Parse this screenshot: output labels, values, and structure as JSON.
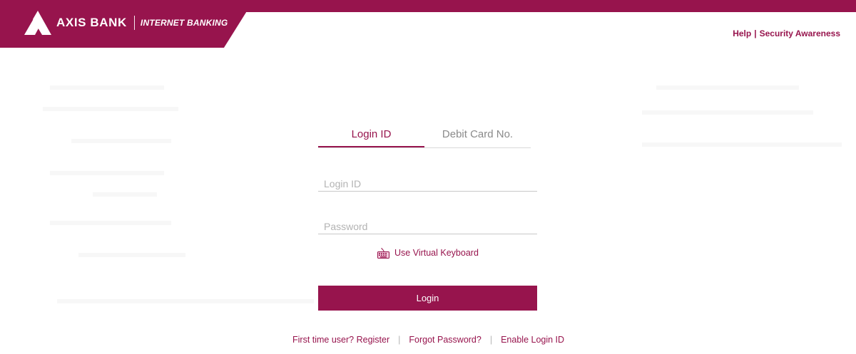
{
  "header": {
    "bank_name": "AXIS BANK",
    "product": "INTERNET BANKING",
    "help": "Help",
    "separator": "|",
    "security": "Security Awareness"
  },
  "colors": {
    "brand": "#97144d"
  },
  "tabs": [
    {
      "label": "Login ID",
      "active": true
    },
    {
      "label": "Debit Card No.",
      "active": false
    }
  ],
  "form": {
    "login_placeholder": "Login ID",
    "password_placeholder": "Password",
    "virtual_keyboard": "Use Virtual Keyboard",
    "login_button": "Login"
  },
  "footer": {
    "register": "First time user? Register",
    "forgot": "Forgot Password?",
    "enable": "Enable Login ID",
    "pipe": "|"
  }
}
